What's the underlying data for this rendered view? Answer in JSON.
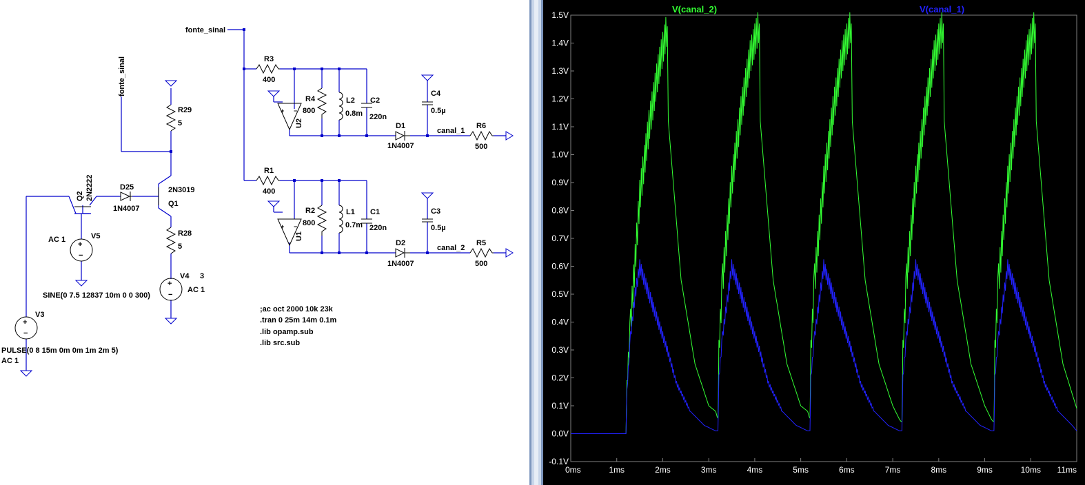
{
  "schematic": {
    "net_labels": {
      "fonte_sinal_top": "fonte_sinal",
      "fonte_sinal_vertical": "fonte_sinal",
      "canal_1": "canal_1",
      "canal_2": "canal_2"
    },
    "components": {
      "R3": {
        "name": "R3",
        "value": "400"
      },
      "R4": {
        "name": "R4",
        "value": "800"
      },
      "L2": {
        "name": "L2",
        "value": "0.8m"
      },
      "C2": {
        "name": "C2",
        "value": "220n"
      },
      "C4": {
        "name": "C4",
        "value": "0.5µ"
      },
      "D1": {
        "name": "D1",
        "value": "1N4007"
      },
      "R6": {
        "name": "R6",
        "value": "500"
      },
      "U2": {
        "name": "U2"
      },
      "R1": {
        "name": "R1",
        "value": "400"
      },
      "R2": {
        "name": "R2",
        "value": "800"
      },
      "L1": {
        "name": "L1",
        "value": "0.7m"
      },
      "C1": {
        "name": "C1",
        "value": "220n"
      },
      "C3": {
        "name": "C3",
        "value": "0.5µ"
      },
      "D2": {
        "name": "D2",
        "value": "1N4007"
      },
      "R5": {
        "name": "R5",
        "value": "500"
      },
      "U1": {
        "name": "U1"
      },
      "R29": {
        "name": "R29",
        "value": "5"
      },
      "Q1": {
        "name": "Q1",
        "value": "2N3019"
      },
      "R28": {
        "name": "R28",
        "value": "5"
      },
      "V4": {
        "name": "V4",
        "value": "3",
        "ac": "AC 1"
      },
      "Q2": {
        "name": "Q2",
        "value": "2N2222"
      },
      "D25": {
        "name": "D25",
        "value": "1N4007"
      },
      "V5": {
        "name": "V5",
        "ac": "AC 1",
        "spec": "SINE(0 7.5 12837 10m 0 0 300)"
      },
      "V3": {
        "name": "V3",
        "spec": "PULSE(0 8 15m 0m 0m 1m 2m 5)",
        "ac": "AC 1"
      }
    },
    "directives": [
      ";ac oct 2000 10k 23k",
      ".tran 0 25m 14m 0.1m",
      ".lib opamp.sub",
      ".lib src.sub"
    ]
  },
  "waveform": {
    "traces": [
      {
        "label": "V(canal_2)",
        "color": "#33ff33"
      },
      {
        "label": "V(canal_1)",
        "color": "#2222ff"
      }
    ],
    "y_ticks": [
      "1.5V",
      "1.4V",
      "1.3V",
      "1.2V",
      "1.1V",
      "1.0V",
      "0.9V",
      "0.8V",
      "0.7V",
      "0.6V",
      "0.5V",
      "0.4V",
      "0.3V",
      "0.2V",
      "0.1V",
      "0.0V",
      "-0.1V"
    ],
    "x_ticks": [
      "0ms",
      "1ms",
      "2ms",
      "3ms",
      "4ms",
      "5ms",
      "6ms",
      "7ms",
      "8ms",
      "9ms",
      "10ms",
      "11ms"
    ]
  },
  "chart_data": {
    "type": "line",
    "xlabel": "",
    "ylabel": "",
    "xlim": [
      0,
      11
    ],
    "ylim": [
      -0.1,
      1.5
    ],
    "x_unit": "ms",
    "y_unit": "V",
    "series": [
      {
        "name": "V(canal_2)",
        "x": [
          0,
          1.2,
          1.22,
          1.3,
          1.4,
          1.5,
          1.7,
          1.9,
          2.1,
          2.12,
          2.4,
          2.7,
          3.0,
          3.15,
          3.2,
          3.22,
          3.3,
          3.5,
          3.7,
          3.9,
          4.1,
          4.12,
          4.4,
          4.7,
          5.0,
          5.15,
          5.2,
          5.22,
          5.3,
          5.5,
          5.7,
          5.9,
          6.1,
          6.12,
          6.4,
          6.7,
          7.0,
          7.15,
          7.2,
          7.22,
          7.3,
          7.5,
          7.7,
          7.9,
          8.1,
          8.12,
          8.4,
          8.7,
          9.0,
          9.15,
          9.2,
          9.22,
          9.3,
          9.5,
          9.7,
          9.9,
          10.1,
          10.12,
          10.4,
          10.7,
          11.0
        ],
        "values": [
          0,
          0,
          0.17,
          0.4,
          0.62,
          0.85,
          1.1,
          1.3,
          1.46,
          1.12,
          0.55,
          0.25,
          0.1,
          0.08,
          0.05,
          0.3,
          0.55,
          0.9,
          1.15,
          1.35,
          1.47,
          1.12,
          0.55,
          0.25,
          0.1,
          0.08,
          0.05,
          0.3,
          0.55,
          0.9,
          1.15,
          1.35,
          1.47,
          1.12,
          0.55,
          0.25,
          0.1,
          0.05,
          0.04,
          0.3,
          0.55,
          0.9,
          1.15,
          1.35,
          1.47,
          1.12,
          0.55,
          0.25,
          0.1,
          0.05,
          0.04,
          0.3,
          0.55,
          0.9,
          1.15,
          1.35,
          1.47,
          1.12,
          0.55,
          0.25,
          0.09
        ]
      },
      {
        "name": "V(canal_1)",
        "x": [
          0,
          1.2,
          1.22,
          1.3,
          1.4,
          1.5,
          1.7,
          1.9,
          2.1,
          2.3,
          2.6,
          2.9,
          3.15,
          3.2,
          3.22,
          3.3,
          3.5,
          3.7,
          3.9,
          4.1,
          4.3,
          4.6,
          4.9,
          5.15,
          5.2,
          5.22,
          5.3,
          5.5,
          5.7,
          5.9,
          6.1,
          6.3,
          6.6,
          6.9,
          7.15,
          7.2,
          7.22,
          7.3,
          7.5,
          7.7,
          7.9,
          8.1,
          8.3,
          8.6,
          8.9,
          9.15,
          9.2,
          9.22,
          9.3,
          9.5,
          9.7,
          9.9,
          10.1,
          10.3,
          10.6,
          10.9,
          11.0
        ],
        "values": [
          0,
          0,
          0.15,
          0.35,
          0.5,
          0.6,
          0.5,
          0.4,
          0.3,
          0.18,
          0.08,
          0.03,
          0.01,
          0.01,
          0.2,
          0.35,
          0.6,
          0.5,
          0.4,
          0.3,
          0.18,
          0.08,
          0.03,
          0.01,
          0.01,
          0.2,
          0.35,
          0.6,
          0.5,
          0.4,
          0.3,
          0.18,
          0.08,
          0.03,
          0.01,
          0.01,
          0.2,
          0.35,
          0.6,
          0.5,
          0.4,
          0.3,
          0.18,
          0.08,
          0.03,
          0.01,
          0.01,
          0.2,
          0.35,
          0.6,
          0.5,
          0.4,
          0.3,
          0.18,
          0.08,
          0.03,
          0.01
        ]
      }
    ]
  }
}
